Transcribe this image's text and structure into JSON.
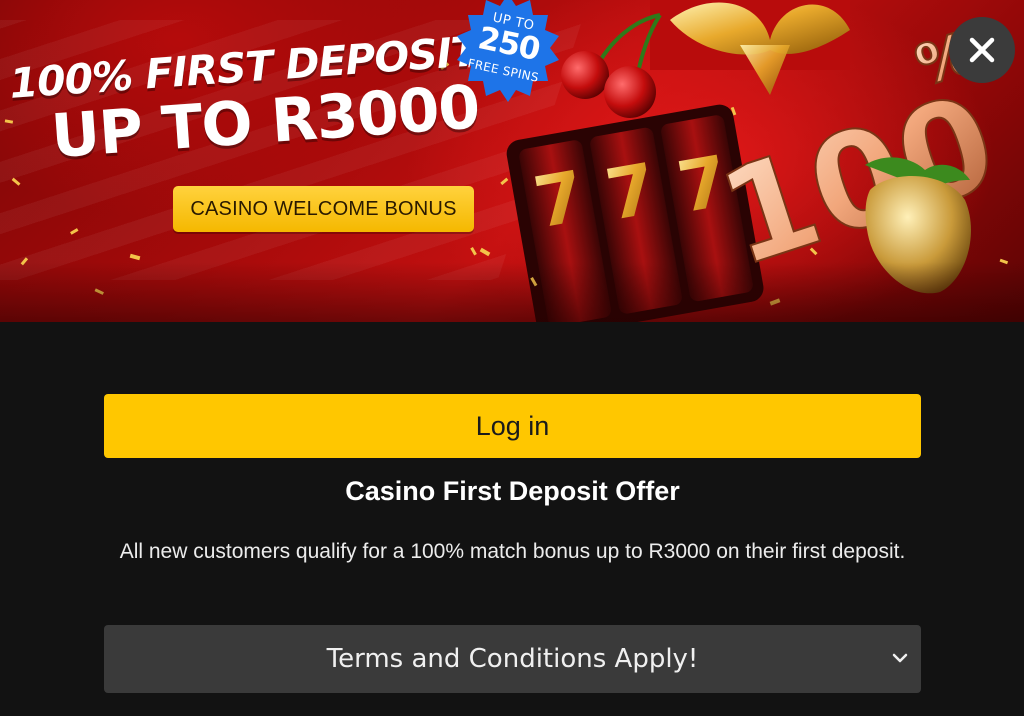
{
  "banner": {
    "headline_line1": "100% FIRST DEPOSIT",
    "headline_line2": "UP TO R3000",
    "welcome_pill": "CASINO WELCOME BONUS",
    "spins_badge": {
      "up_to": "UP TO",
      "number": "250",
      "free_spins": "FREE SPINS"
    },
    "art_text": "100%",
    "close_icon": "close-icon",
    "colors": {
      "banner_red": "#c21010",
      "badge_blue": "#1e74e8",
      "pill_yellow": "#ffc700"
    }
  },
  "actions": {
    "login_label": "Log in"
  },
  "offer": {
    "title": "Casino First Deposit Offer",
    "description": "All new customers qualify for a 100% match bonus up to R3000 on their first deposit."
  },
  "terms": {
    "label": "Terms and Conditions Apply!",
    "icon": "chevron-down-icon"
  },
  "theme": {
    "background": "#121212",
    "accent": "#ffc700",
    "terms_background": "#3a3a3a"
  }
}
